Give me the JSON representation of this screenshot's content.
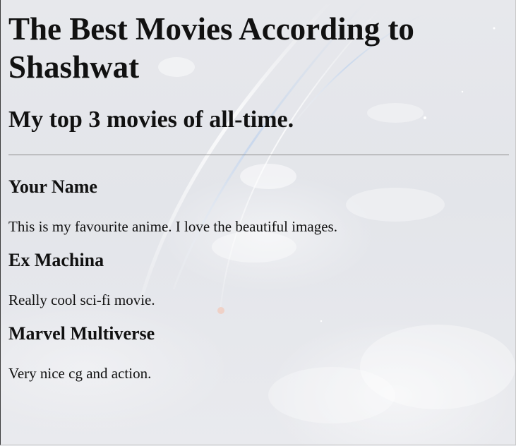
{
  "page": {
    "title": "The Best Movies According to Shashwat",
    "subtitle": "My top 3 movies of all-time."
  },
  "movies": [
    {
      "title": "Your Name",
      "description": "This is my favourite anime. I love the beautiful images."
    },
    {
      "title": "Ex Machina",
      "description": "Really cool sci-fi movie."
    },
    {
      "title": "Marvel Multiverse",
      "description": "Very nice cg and action."
    }
  ],
  "colors": {
    "text": "#111111",
    "divider": "#8c8c8c",
    "background": "#e5e6ea"
  }
}
